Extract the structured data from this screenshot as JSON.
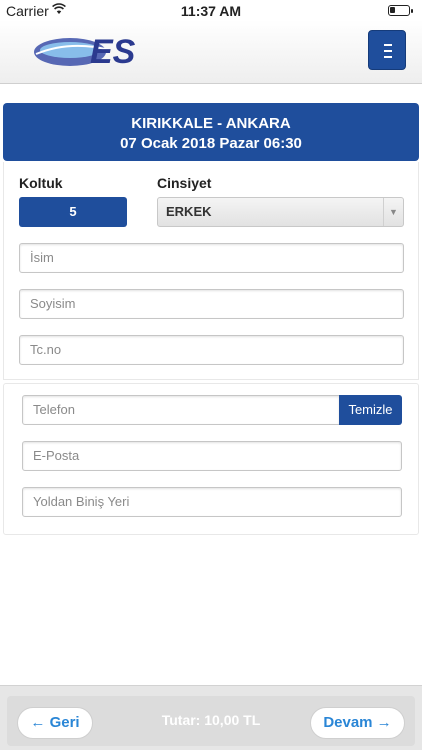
{
  "status_bar": {
    "carrier": "Carrier",
    "time": "11:37 AM"
  },
  "header": {
    "logo_text": "ES",
    "menu_icon": "hamburger-icon",
    "accent": "#1f4e9c"
  },
  "trip": {
    "route": "KIRIKKALE - ANKARA",
    "datetime": "07 Ocak 2018 Pazar 06:30"
  },
  "passenger": {
    "seat_label": "Koltuk",
    "seat_value": "5",
    "gender_label": "Cinsiyet",
    "gender_value": "ERKEK",
    "name_placeholder": "İsim",
    "surname_placeholder": "Soyisim",
    "tc_placeholder": "Tc.no"
  },
  "contact": {
    "phone_placeholder": "Telefon",
    "clear_label": "Temizle",
    "email_placeholder": "E-Posta",
    "boarding_placeholder": "Yoldan Biniş Yeri"
  },
  "footer": {
    "back_label": "← Geri",
    "total_label": "Tutar: 10,00 TL",
    "continue_label": "Devam →"
  }
}
